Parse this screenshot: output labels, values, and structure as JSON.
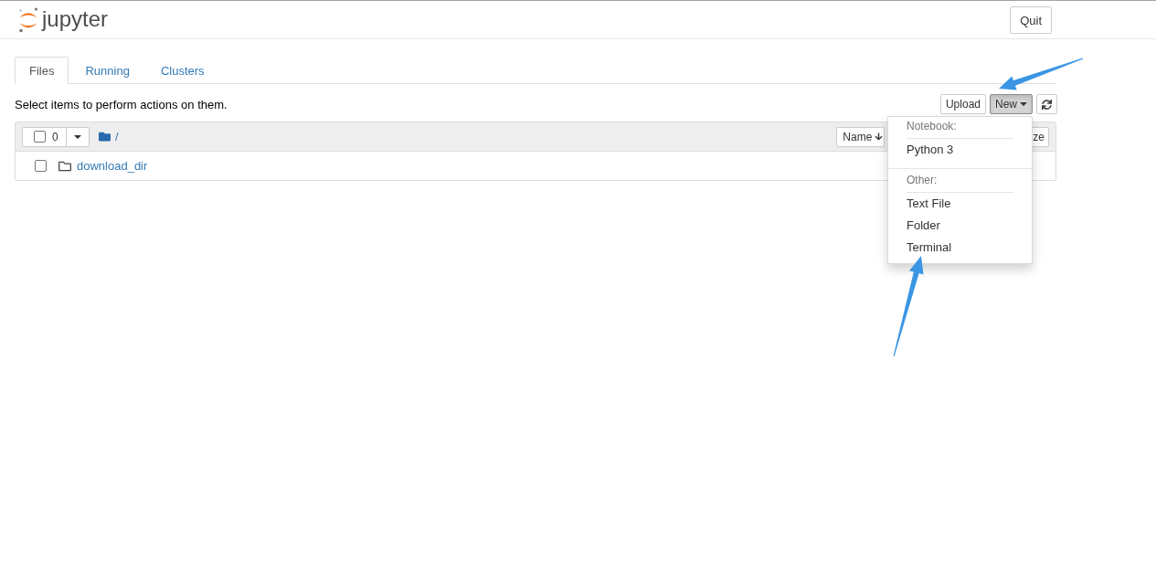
{
  "header": {
    "logo_text": "jupyter",
    "quit_button": "Quit"
  },
  "tabs": [
    {
      "label": "Files",
      "selected": true
    },
    {
      "label": "Running",
      "selected": false
    },
    {
      "label": "Clusters",
      "selected": false
    }
  ],
  "toolbar": {
    "hint": "Select items to perform actions on them.",
    "buttons": [
      {
        "kind": "upload",
        "label": "Upload"
      },
      {
        "kind": "new",
        "label": "New",
        "open": true
      },
      {
        "kind": "refresh"
      }
    ]
  },
  "new_menu": {
    "sections": [
      {
        "heading": "Notebook:",
        "items": [
          "Python 3"
        ]
      },
      {
        "heading": "Other:",
        "items": [
          "Text File",
          "Folder",
          "Terminal"
        ]
      }
    ]
  },
  "file_list": {
    "select_all": {
      "checked": false,
      "count": "0"
    },
    "path": "/",
    "sort_buttons": [
      {
        "label": "Name",
        "sorted": true
      },
      {
        "label": "ze",
        "sorted": false
      }
    ],
    "items": [
      {
        "kind": "folder",
        "name": "download_dir",
        "checked": false
      }
    ]
  },
  "annotations": [
    {
      "kind": "arrow"
    },
    {
      "kind": "arrow"
    }
  ]
}
